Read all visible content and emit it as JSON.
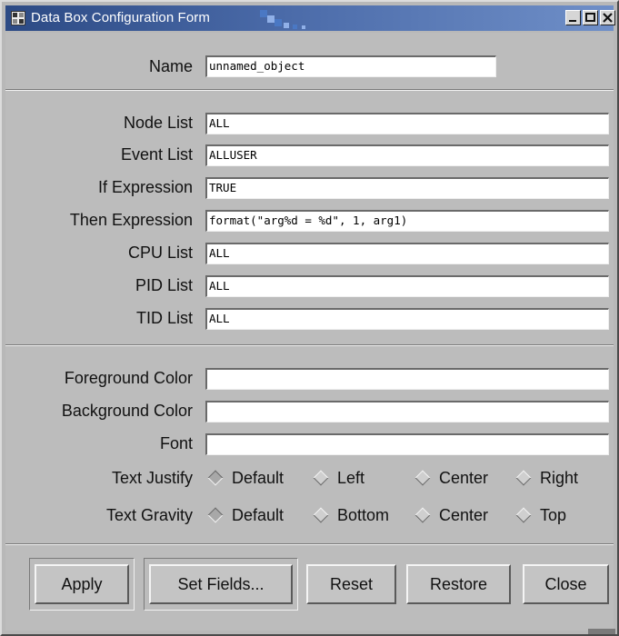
{
  "window": {
    "title": "Data Box Configuration Form"
  },
  "form": {
    "name": {
      "label": "Name",
      "value": "unnamed_object"
    },
    "filters": [
      {
        "key": "node_list",
        "label": "Node List",
        "value": "ALL"
      },
      {
        "key": "event_list",
        "label": "Event List",
        "value": "ALLUSER"
      },
      {
        "key": "if_expression",
        "label": "If Expression",
        "value": "TRUE"
      },
      {
        "key": "then_expression",
        "label": "Then Expression",
        "value": "format(\"arg%d = %d\", 1, arg1)"
      },
      {
        "key": "cpu_list",
        "label": "CPU List",
        "value": "ALL"
      },
      {
        "key": "pid_list",
        "label": "PID List",
        "value": "ALL"
      },
      {
        "key": "tid_list",
        "label": "TID List",
        "value": "ALL"
      }
    ],
    "appearance": [
      {
        "key": "foreground_color",
        "label": "Foreground Color",
        "value": ""
      },
      {
        "key": "background_color",
        "label": "Background Color",
        "value": ""
      },
      {
        "key": "font",
        "label": "Font",
        "value": ""
      }
    ],
    "text_justify": {
      "label": "Text Justify",
      "selected": "Default",
      "options": [
        "Default",
        "Left",
        "Center",
        "Right"
      ]
    },
    "text_gravity": {
      "label": "Text Gravity",
      "selected": "Default",
      "options": [
        "Default",
        "Bottom",
        "Center",
        "Top"
      ]
    }
  },
  "buttons": {
    "apply": "Apply",
    "set_fields": "Set Fields...",
    "reset": "Reset",
    "restore": "Restore",
    "close": "Close"
  },
  "colors": {
    "titlebar_start": "#2c4a84",
    "titlebar_end": "#6f8fc8",
    "background": "#bcbcbc"
  }
}
